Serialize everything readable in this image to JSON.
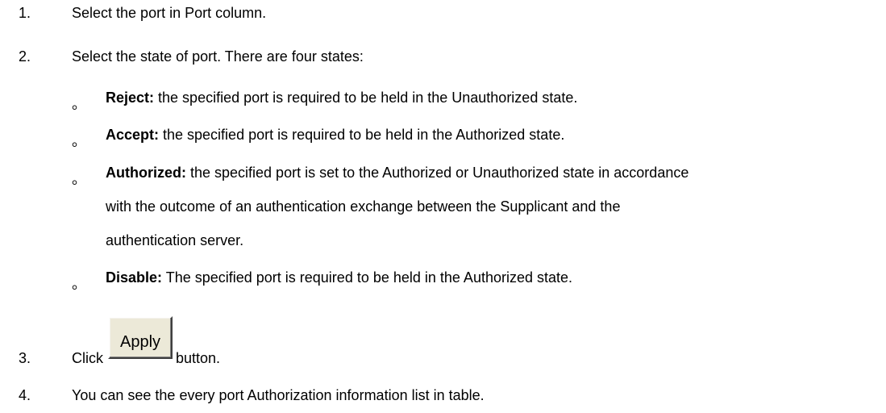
{
  "steps": [
    {
      "num": "1.",
      "text": "Select the port in Port column."
    },
    {
      "num": "2.",
      "text": "Select the state of port. There are four states:"
    },
    {
      "num": "3.",
      "text_before": "Click",
      "text_after": "button."
    },
    {
      "num": "4.",
      "text": "You can see the every port Authorization information list in table."
    }
  ],
  "bullet_glyph": "。",
  "states": [
    {
      "term": "Reject:",
      "desc": " the specified port is required to be held in the Unauthorized state."
    },
    {
      "term": "Accept:",
      "desc": " the specified port is required to be held in the Authorized state."
    },
    {
      "term": "Authorized:",
      "desc": " the specified port is set to the Authorized or Unauthorized state in accordance",
      "desc_cont": [
        "with the outcome of an authentication exchange between the Supplicant and the",
        "authentication server."
      ]
    },
    {
      "term": "Disable:",
      "desc": " The specified port is required to be held in the Authorized state."
    }
  ],
  "apply_button": {
    "label": "Apply"
  }
}
